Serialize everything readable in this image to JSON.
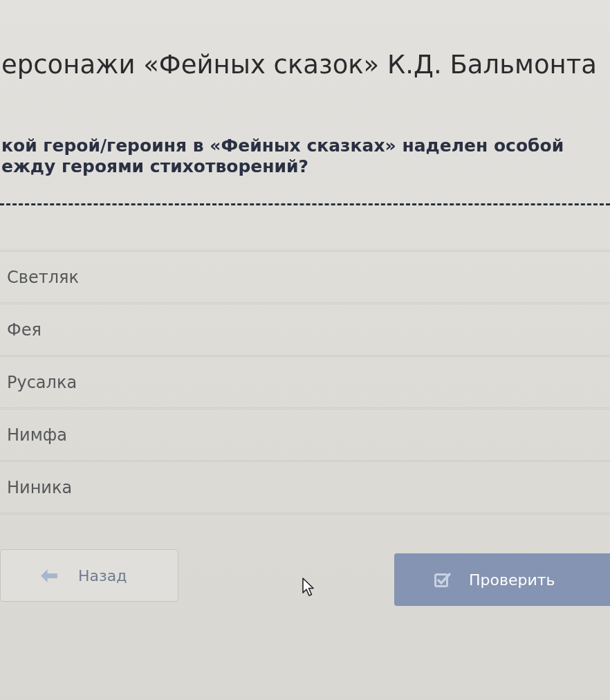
{
  "page": {
    "title": "ерсонажи «Фейных сказок» К.Д. Бальмонта"
  },
  "question": {
    "lines": [
      "кой герой/героиня в «Фейных сказках» наделен особой",
      "ежду героями стихотворений?"
    ]
  },
  "options": [
    {
      "label": "Светляк",
      "selected": false
    },
    {
      "label": "Фея",
      "selected": false
    },
    {
      "label": "Русалка",
      "selected": false
    },
    {
      "label": "Нимфа",
      "selected": false
    },
    {
      "label": "Ниника",
      "selected": false
    }
  ],
  "buttons": [
    {
      "kind": "back",
      "label": "Назад",
      "disabled": true
    },
    {
      "kind": "check",
      "label": "Проверить",
      "disabled": true
    }
  ]
}
